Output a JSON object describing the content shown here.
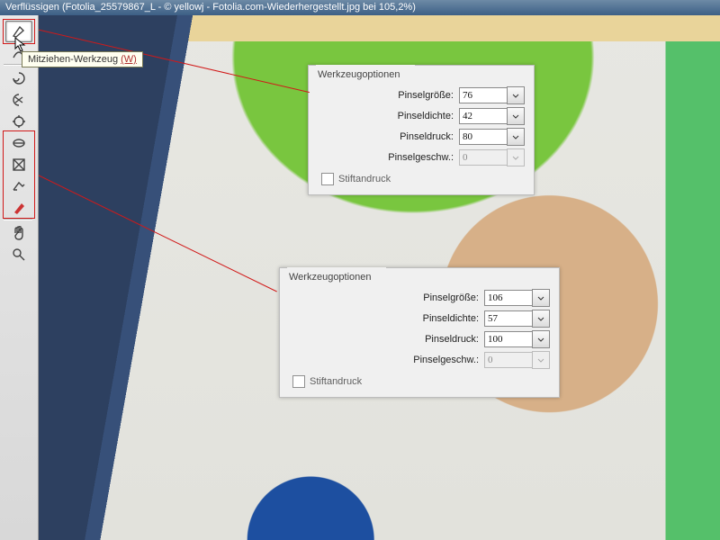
{
  "window": {
    "title": "Verflüssigen (Fotolia_25579867_L - © yellowj - Fotolia.com-Wiederhergestellt.jpg bei 105,2%)"
  },
  "tooltip": {
    "label": "Mitziehen-Werkzeug ",
    "hotkey": "(W)"
  },
  "tools": [
    {
      "name": "forward-warp",
      "selected": true
    },
    {
      "name": "reconstruct"
    },
    {
      "name": "twirl"
    },
    {
      "name": "pucker"
    },
    {
      "name": "bloat"
    },
    {
      "name": "push-left"
    },
    {
      "name": "mirror"
    },
    {
      "name": "turbulence"
    },
    {
      "name": "freeze-mask"
    },
    {
      "name": "thaw-mask"
    },
    {
      "name": "hand"
    },
    {
      "name": "zoom"
    }
  ],
  "panel1": {
    "legend": "Werkzeugoptionen",
    "rows": {
      "size": {
        "label": "Pinselgröße:",
        "value": "76"
      },
      "density": {
        "label": "Pinseldichte:",
        "value": "42"
      },
      "pressure": {
        "label": "Pinseldruck:",
        "value": "80"
      },
      "rate": {
        "label": "Pinselgeschw.:",
        "value": "0",
        "disabled": true
      }
    },
    "stylus": {
      "label": "Stiftandruck"
    }
  },
  "panel2": {
    "legend": "Werkzeugoptionen",
    "rows": {
      "size": {
        "label": "Pinselgröße:",
        "value": "106"
      },
      "density": {
        "label": "Pinseldichte:",
        "value": "57"
      },
      "pressure": {
        "label": "Pinseldruck:",
        "value": "100"
      },
      "rate": {
        "label": "Pinselgeschw.:",
        "value": "0",
        "disabled": true
      }
    },
    "stylus": {
      "label": "Stiftandruck"
    }
  }
}
